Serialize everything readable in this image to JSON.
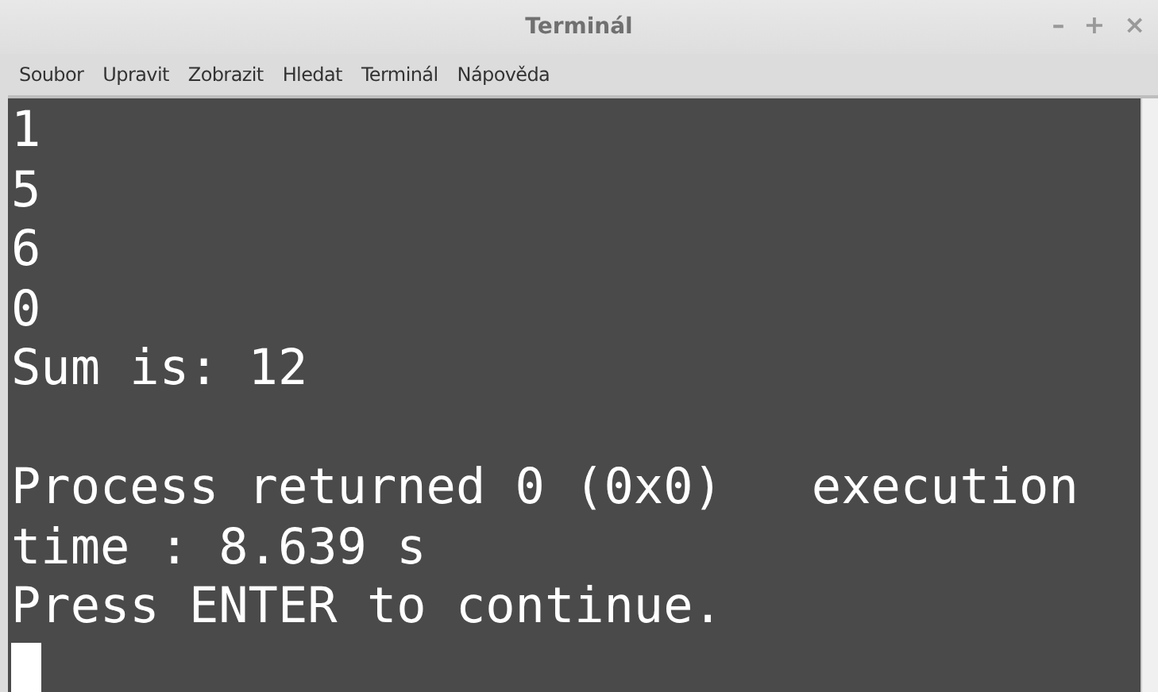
{
  "window": {
    "title": "Terminál"
  },
  "window_controls": [
    "–",
    "+",
    "×"
  ],
  "menu": [
    "Soubor",
    "Upravit",
    "Zobrazit",
    "Hledat",
    "Terminál",
    "Nápověda"
  ],
  "terminal": {
    "lines": [
      {
        "kind": "text",
        "text": "1"
      },
      {
        "kind": "text",
        "text": "5"
      },
      {
        "kind": "text",
        "text": "6"
      },
      {
        "kind": "text",
        "text": "0"
      },
      {
        "kind": "text",
        "text": "Sum is: 12"
      },
      {
        "kind": "blank"
      },
      {
        "kind": "text",
        "text": "Process returned 0 (0x0)   execution"
      },
      {
        "kind": "text",
        "text": "time : 8.639 s"
      },
      {
        "kind": "text",
        "text": "Press ENTER to continue."
      },
      {
        "kind": "cursor"
      }
    ]
  }
}
